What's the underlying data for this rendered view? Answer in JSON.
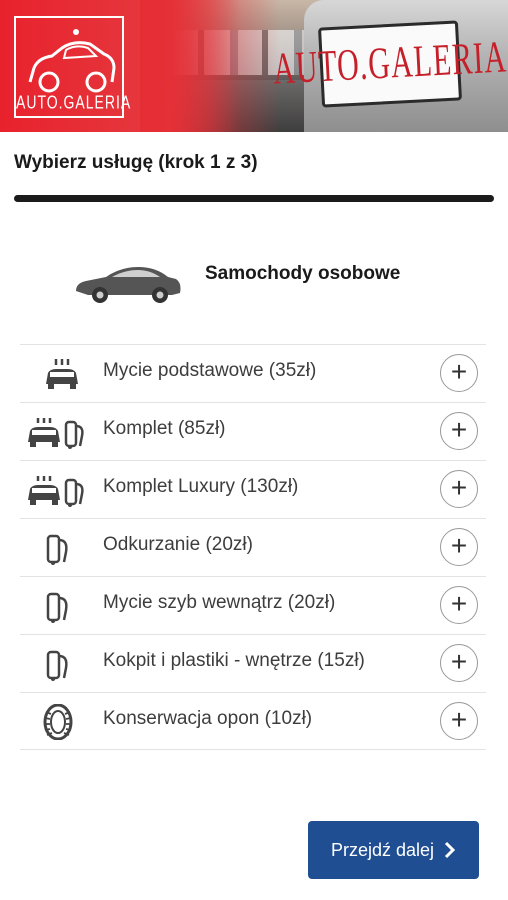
{
  "header": {
    "logo_text": "AUTO.GALERIA",
    "plate_text": "AUTO.GALERIA"
  },
  "step": {
    "title": "Wybierz usługę (krok 1 z 3)"
  },
  "category": {
    "label": "Samochody osobowe",
    "icon": "car-icon"
  },
  "services": [
    {
      "label": "Mycie podstawowe (35zł)",
      "icon": "car-wash-icon"
    },
    {
      "label": "Komplet (85zł)",
      "icon": "car-wash-vacuum-icon"
    },
    {
      "label": "Komplet Luxury (130zł)",
      "icon": "car-wash-vacuum-icon"
    },
    {
      "label": "Odkurzanie (20zł)",
      "icon": "vacuum-icon"
    },
    {
      "label": "Mycie szyb wewnątrz (20zł)",
      "icon": "vacuum-icon"
    },
    {
      "label": "Kokpit i plastiki - wnętrze (15zł)",
      "icon": "vacuum-icon"
    },
    {
      "label": "Konserwacja opon (10zł)",
      "icon": "tire-icon"
    }
  ],
  "add_symbol": "+",
  "next_button": {
    "label": "Przejdź dalej",
    "icon": "chevron-right-icon"
  },
  "colors": {
    "brand_red": "#e8222d",
    "primary_button": "#1f4e92"
  }
}
